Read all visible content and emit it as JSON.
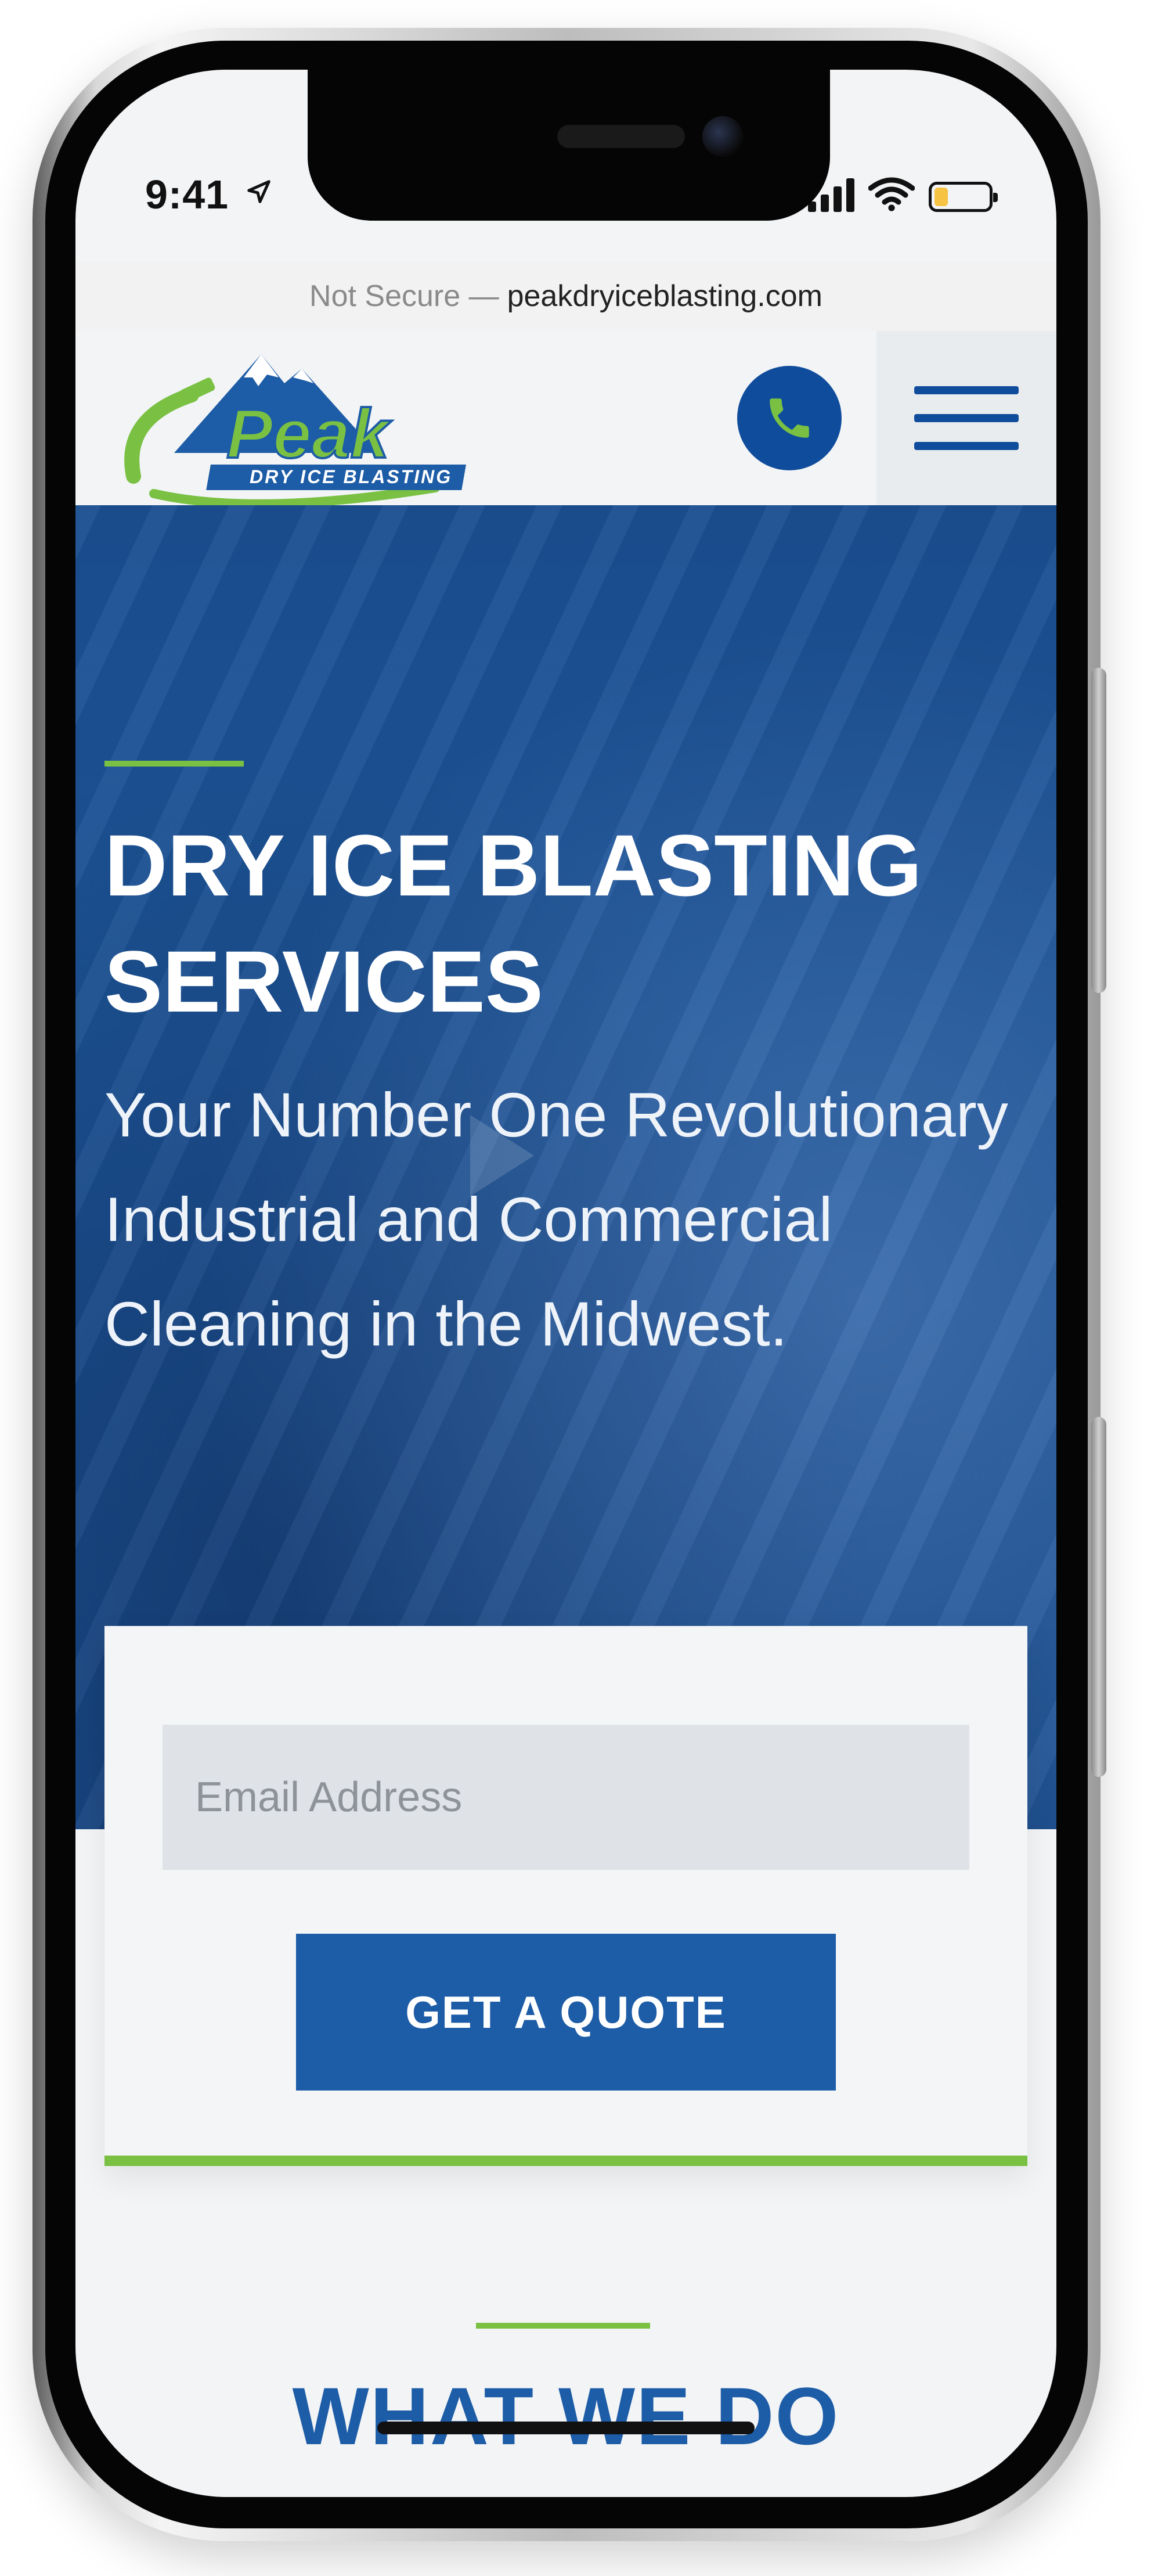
{
  "status_bar": {
    "time": "9:41",
    "location_icon": "location-arrow-icon",
    "signal_icon": "cellular-signal-icon",
    "wifi_icon": "wifi-icon",
    "battery_icon": "battery-icon",
    "battery_level": 0.25
  },
  "browser": {
    "security_label": "Not Secure —",
    "domain": "peakdryiceblasting.com"
  },
  "header": {
    "logo_name": "Peak",
    "logo_tagline": "DRY ICE BLASTING",
    "call_icon": "phone-icon",
    "menu_icon": "hamburger-menu-icon"
  },
  "hero": {
    "title": "DRY ICE BLASTING SERVICES",
    "subtitle": "Your Number One Revolutionary Industrial and Commercial Cleaning in the Midwest."
  },
  "quote_form": {
    "email_placeholder": "Email Address",
    "submit_label": "GET A QUOTE"
  },
  "next_section": {
    "title": "WHAT WE DO"
  },
  "colors": {
    "brand_blue": "#1d5ca6",
    "accent_green": "#7ac143",
    "hero_blue": "#1b4f92"
  }
}
